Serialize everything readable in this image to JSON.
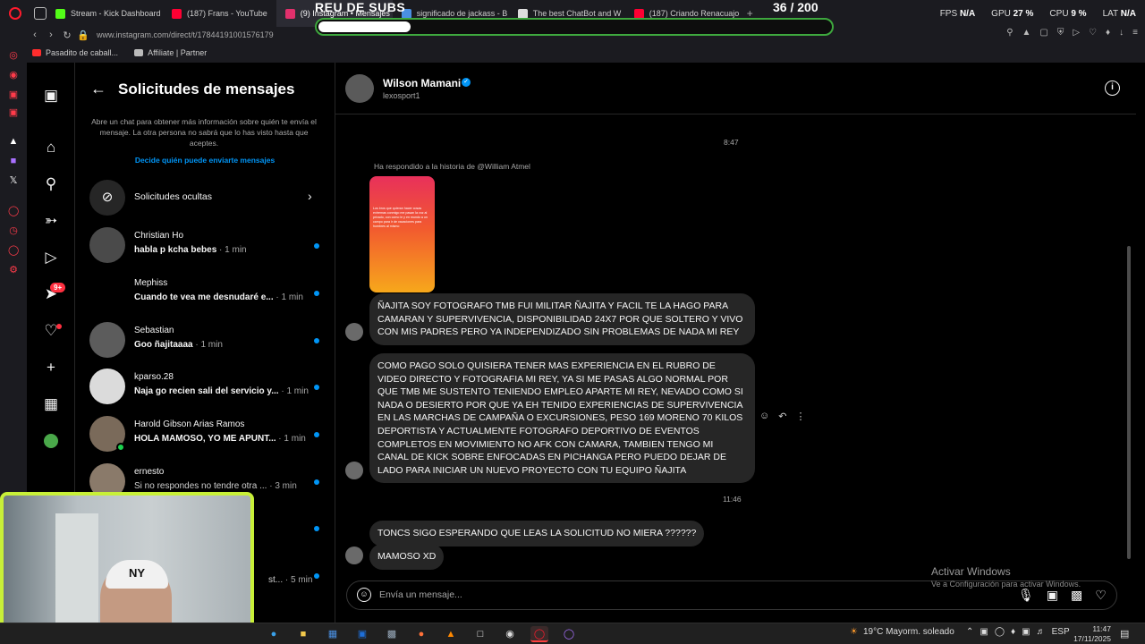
{
  "browser": {
    "tabs": [
      {
        "label": "Stream - Kick Dashboard",
        "color": "#53fc18"
      },
      {
        "label": "(187) Frans - YouTube",
        "color": "#ff0033"
      },
      {
        "label": "(9) Instagram • Mensajes",
        "color": "#e1306c"
      },
      {
        "label": "significado de jackass - B",
        "color": "#4a90e2"
      },
      {
        "label": "The best ChatBot and W",
        "color": "#dddddd"
      },
      {
        "label": "(187) Criando Renacuajo",
        "color": "#ff0033"
      }
    ],
    "url": "www.instagram.com/direct/t/17844191001576179",
    "stats": {
      "fps_label": "FPS",
      "fps": "N/A",
      "gpu_label": "GPU",
      "gpu": "27 %",
      "cpu_label": "CPU",
      "cpu": "9 %",
      "lat_label": "LAT",
      "lat": "N/A"
    },
    "bookmarks": [
      {
        "label": "Pasadito de caball...",
        "color": "#ff2d2d"
      },
      {
        "label": "Affiliate | Partner",
        "color": "#bbbbbb"
      }
    ]
  },
  "overlay": {
    "title": "REU DE SUBS",
    "count": "36  / 200",
    "progress": 0.18
  },
  "ig_nav": {
    "badge": "9+"
  },
  "requests": {
    "title": "Solicitudes de mensajes",
    "description": "Abre un chat para obtener más información sobre quién te envía el mensaje. La otra persona no sabrá que lo has visto hasta que aceptes.",
    "link": "Decide quién puede enviarte mensajes",
    "hidden": "Solicitudes ocultas",
    "conversations": [
      {
        "name": "Christian Ho",
        "snippet": "habla p kcha bebes",
        "time": " · 1 min",
        "online": false
      },
      {
        "name": "Mephiss",
        "snippet": "Cuando te vea me desnudaré e...",
        "time": " · 1 min",
        "online": false
      },
      {
        "name": "Sebastian",
        "snippet": "Goo ñajitaaaa",
        "time": " · 1 min",
        "online": false
      },
      {
        "name": "kparso.28",
        "snippet": "Ñaja go recien sali del servicio y...",
        "time": " · 1 min",
        "online": false
      },
      {
        "name": "Harold Gibson Arias Ramos",
        "snippet": "HOLA MAMOSO, YO ME APUNT...",
        "time": " · 1 min",
        "online": true
      },
      {
        "name": "ernesto",
        "snippet": "Si no respondes no tendre otra ...",
        "time": " · 3 min",
        "online": false
      },
      {
        "name": "",
        "snippet": "",
        "time": "",
        "online": false
      },
      {
        "name": "",
        "snippet": "st...",
        "time": " · 5 min",
        "online": false
      }
    ]
  },
  "chat": {
    "name": "Wilson Mamani",
    "username": "lexosport1",
    "time1": "8:47",
    "story_note": "Ha respondido a la historia de @William Atmel",
    "story_text": "Los bros que quieran hacer cosas extremas conmigo me pasan la voz al privado, con como le y en mundo a un campo para ir de vacaciones para hombres al mismo",
    "messages": [
      "ÑAJITA SOY FOTOGRAFO TMB FUI MILITAR ÑAJITA Y FACIL TE LA HAGO PARA CAMARAN Y SUPERVIVENCIA, DISPONIBILIDAD 24X7 POR QUE SOLTERO Y VIVO CON MIS PADRES PERO YA INDEPENDIZADO SIN PROBLEMAS DE NADA MI REY",
      "COMO PAGO SOLO QUISIERA TENER MAS EXPERIENCIA EN EL RUBRO DE VIDEO DIRECTO Y FOTOGRAFIA MI REY, YA SI ME PASAS ALGO NORMAL POR QUE TMB ME SUSTENTO TENIENDO EMPLEO APARTE MI REY, NEVADO COMO SI NADA O DESIERTO POR QUE YA EH TENIDO EXPERIENCIAS DE SUPERVIVENCIA EN LAS MARCHAS DE CAMPAÑA O EXCURSIONES, PESO 169 MORENO 70 KILOS DEPORTISTA Y ACTUALMENTE FOTOGRAFO DEPORTIVO DE EVENTOS COMPLETOS EN MOVIMIENTO NO AFK CON CAMARA, TAMBIEN TENGO MI CANAL DE KICK SOBRE ENFOCADAS EN PICHANGA PERO PUEDO DEJAR DE LADO PARA INICIAR UN NUEVO PROYECTO CON TU EQUIPO ÑAJITA",
      "TONCS SIGO ESPERANDO QUE LEAS LA SOLICITUD NO MIERA ??????",
      "MAMOSO XD"
    ],
    "time2": "11:46",
    "composer_placeholder": "Envía un mensaje..."
  },
  "windows": {
    "activate": "Activar Windows",
    "activate_sub": "Ve a Configuración para activar Windows.",
    "weather": "19°C  Mayorm. soleado",
    "lang": "ESP",
    "time": "11:47",
    "date": "17/11/2025"
  }
}
